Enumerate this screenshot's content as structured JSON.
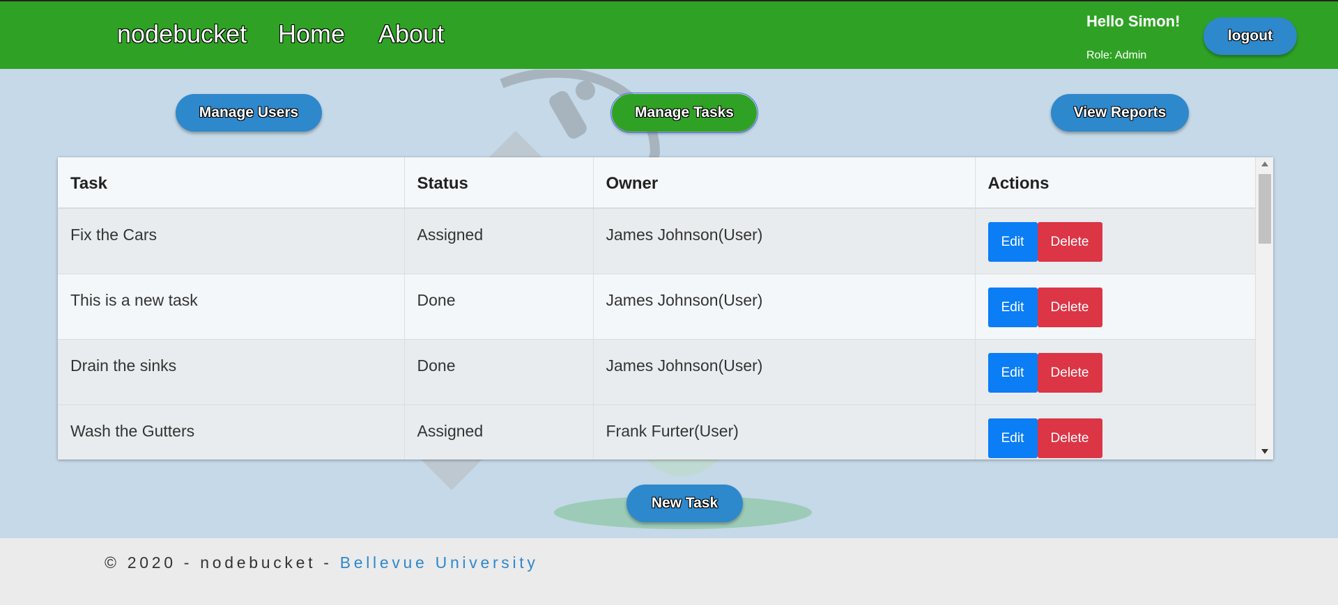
{
  "nav": {
    "brand": "nodebucket",
    "links": [
      "Home",
      "About"
    ],
    "greeting": "Hello Simon!",
    "role": "Role: Admin",
    "logout_label": "logout"
  },
  "admin_tabs": {
    "manage_users": "Manage Users",
    "manage_tasks": "Manage Tasks",
    "view_reports": "View Reports",
    "active": "Manage Tasks"
  },
  "table": {
    "columns": [
      "Task",
      "Status",
      "Owner",
      "Actions"
    ],
    "rows": [
      {
        "task": "Fix the Cars",
        "status": "Assigned",
        "owner": "James Johnson(User)"
      },
      {
        "task": "This is a new task",
        "status": "Done",
        "owner": "James Johnson(User)"
      },
      {
        "task": "Drain the sinks",
        "status": "Done",
        "owner": "James Johnson(User)"
      },
      {
        "task": "Wash the Gutters",
        "status": "Assigned",
        "owner": "Frank Furter(User)"
      }
    ],
    "edit_label": "Edit",
    "delete_label": "Delete"
  },
  "new_task_label": "New Task",
  "footer": {
    "text": "© 2020 - nodebucket - ",
    "link": "Bellevue University"
  },
  "colors": {
    "navbar": "#2fa225",
    "accent": "#2e88cc",
    "edit": "#0b7df5",
    "delete": "#db3546",
    "background": "#c5d9e8"
  }
}
